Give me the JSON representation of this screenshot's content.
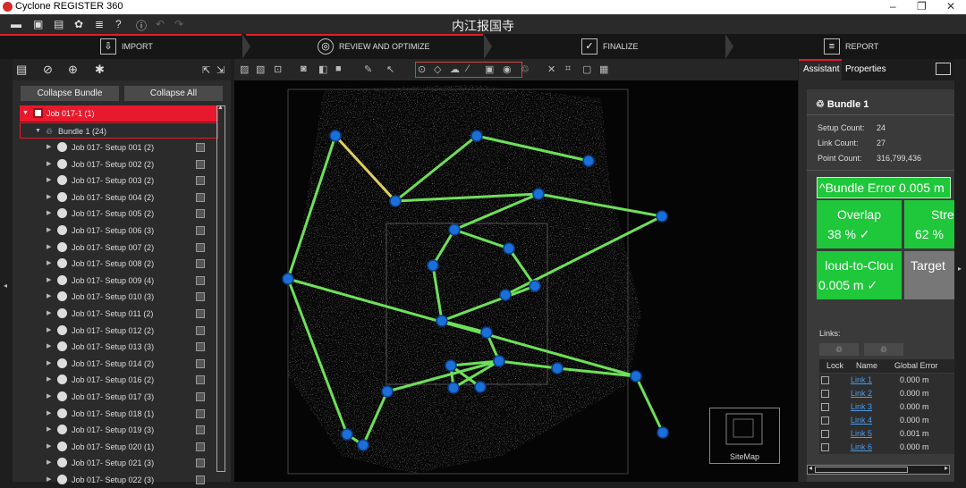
{
  "titlebar": {
    "app_title": "Cyclone REGISTER 360",
    "minimize": "–",
    "maximize": "❐",
    "close": "✕"
  },
  "toolbar": {
    "document_title": "内江报国寺"
  },
  "steps": [
    {
      "label": "IMPORT",
      "icon": "⇩"
    },
    {
      "label": "REVIEW AND OPTIMIZE",
      "icon": "◎"
    },
    {
      "label": "FINALIZE",
      "icon": "✓"
    },
    {
      "label": "REPORT",
      "icon": "≡"
    }
  ],
  "left_panel": {
    "collapse_bundle": "Collapse Bundle",
    "collapse_all": "Collapse All",
    "job": "Job 017-1 (1)",
    "bundle": "Bundle 1 (24)",
    "setups": [
      "Job 017- Setup 001 (2)",
      "Job 017- Setup 002 (2)",
      "Job 017- Setup 003 (2)",
      "Job 017- Setup 004 (2)",
      "Job 017- Setup 005 (2)",
      "Job 017- Setup 006 (3)",
      "Job 017- Setup 007 (2)",
      "Job 017- Setup 008 (2)",
      "Job 017- Setup 009 (4)",
      "Job 017- Setup 010 (3)",
      "Job 017- Setup 011 (2)",
      "Job 017- Setup 012 (2)",
      "Job 017- Setup 013 (3)",
      "Job 017- Setup 014 (2)",
      "Job 017- Setup 016 (2)",
      "Job 017- Setup 017 (3)",
      "Job 017- Setup 018 (1)",
      "Job 017- Setup 019 (3)",
      "Job 017- Setup 020 (1)",
      "Job 017- Setup 021 (3)",
      "Job 017- Setup 022 (3)"
    ]
  },
  "viewport": {
    "sitemap_label": "SiteMap"
  },
  "right_panel": {
    "tab_assistant": "Assistant",
    "tab_properties": "Properties",
    "bundle_title": "Bundle 1",
    "setup_count_label": "Setup Count:",
    "setup_count": "24",
    "link_count_label": "Link Count:",
    "link_count": "27",
    "point_count_label": "Point Count:",
    "point_count": "316,799,436",
    "bundle_error": "^Bundle Error 0.005 m",
    "overlap_label": "Overlap",
    "overlap_value": "38 %  ✓",
    "strength_label": "Stren",
    "strength_value": "62 %",
    "c2c_label": "loud-to-Clou",
    "c2c_value": "0.005 m   ✓",
    "target_label": "Target",
    "target_value": "--",
    "links_label": "Links:",
    "col_lock": "Lock",
    "col_name": "Name",
    "col_error": "Global Error",
    "links": [
      {
        "name": "Link 1",
        "error": "0.000 m"
      },
      {
        "name": "Link 2",
        "error": "0.000 m"
      },
      {
        "name": "Link 3",
        "error": "0.000 m"
      },
      {
        "name": "Link 4",
        "error": "0.000 m"
      },
      {
        "name": "Link 5",
        "error": "0.001 m"
      },
      {
        "name": "Link 6",
        "error": "0.000 m"
      }
    ]
  },
  "colors": {
    "accent_red": "#e8192c",
    "pass_green": "#1fc73a",
    "link_line": "#6ee05a",
    "setup_node": "#1a6fd8"
  }
}
